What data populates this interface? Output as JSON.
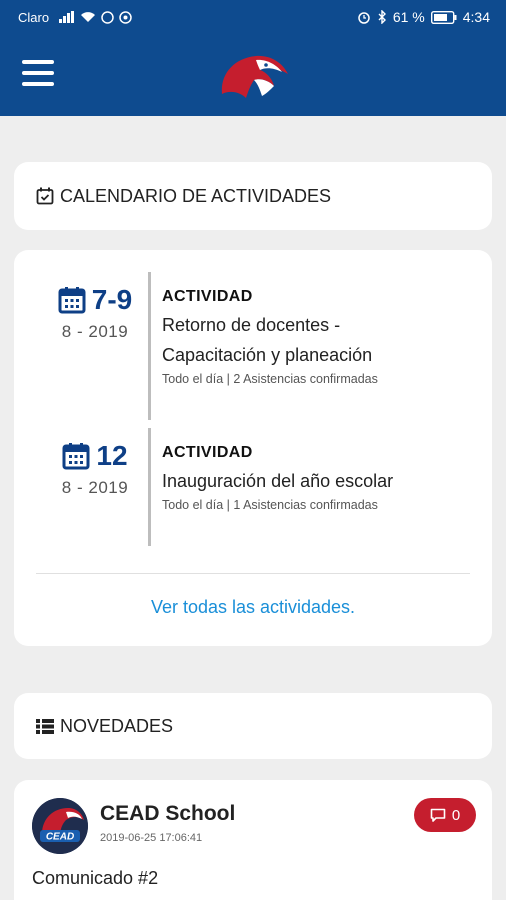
{
  "status_bar": {
    "carrier": "Claro",
    "battery_percent": "61 %",
    "time": "4:34"
  },
  "app_bar": {
    "menu_icon": "hamburger-menu-icon",
    "logo_icon": "eagle-logo-icon"
  },
  "calendar": {
    "header": "CALENDARIO DE ACTIVIDADES",
    "header_icon": "calendar-check-icon",
    "events": [
      {
        "day": "7-9",
        "month_year": "8 - 2019",
        "type": "ACTIVIDAD",
        "title_line1": "Retorno de docentes -",
        "title_line2": "Capacitación y planeación",
        "meta": "Todo el día | 2 Asistencias confirmadas"
      },
      {
        "day": "12",
        "month_year": "8 - 2019",
        "type": "ACTIVIDAD",
        "title_line1": "Inauguración del año escolar",
        "title_line2": "",
        "meta": "Todo el día | 1 Asistencias confirmadas"
      }
    ],
    "see_all": "Ver todas las actividades."
  },
  "news": {
    "header": "NOVEDADES",
    "header_icon": "list-icon",
    "posts": [
      {
        "author": "CEAD School",
        "avatar_text": "CEAD",
        "date": "2019-06-25 17:06:41",
        "comments": "0",
        "text": "Comunicado #2"
      }
    ]
  },
  "colors": {
    "primary": "#0e4b8f",
    "date_blue": "#0e3f86",
    "link": "#1a8fd8",
    "badge_red": "#c51e2e",
    "background": "#eeeeee"
  }
}
